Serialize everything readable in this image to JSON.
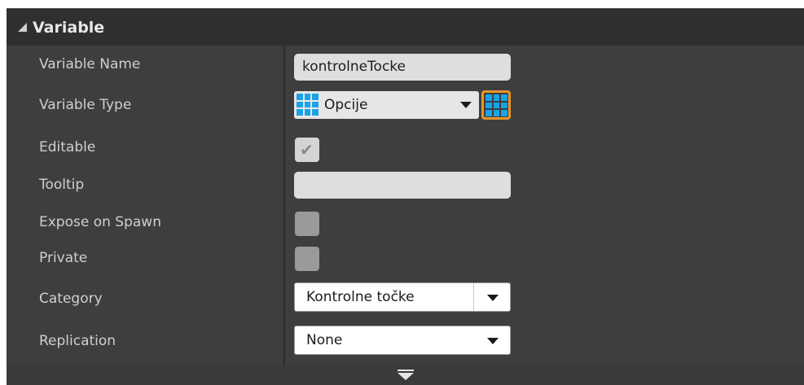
{
  "section": {
    "title": "Variable"
  },
  "rows": {
    "variable_name": {
      "label": "Variable Name",
      "value": "kontrolneTocke"
    },
    "variable_type": {
      "label": "Variable Type",
      "value": "Opcije",
      "icon": "grid-icon"
    },
    "editable": {
      "label": "Editable",
      "checked": true
    },
    "tooltip": {
      "label": "Tooltip",
      "value": ""
    },
    "expose_on_spawn": {
      "label": "Expose on Spawn",
      "checked": false
    },
    "private": {
      "label": "Private",
      "checked": false
    },
    "category": {
      "label": "Category",
      "value": "Kontrolne točke"
    },
    "replication": {
      "label": "Replication",
      "value": "None"
    }
  },
  "colors": {
    "panel_bg": "#3e3e3e",
    "header_bg": "#2f2f2f",
    "type_icon": "#19a3e8",
    "container_accent": "#e8962a"
  },
  "icons": {
    "checkmark": "✔"
  }
}
